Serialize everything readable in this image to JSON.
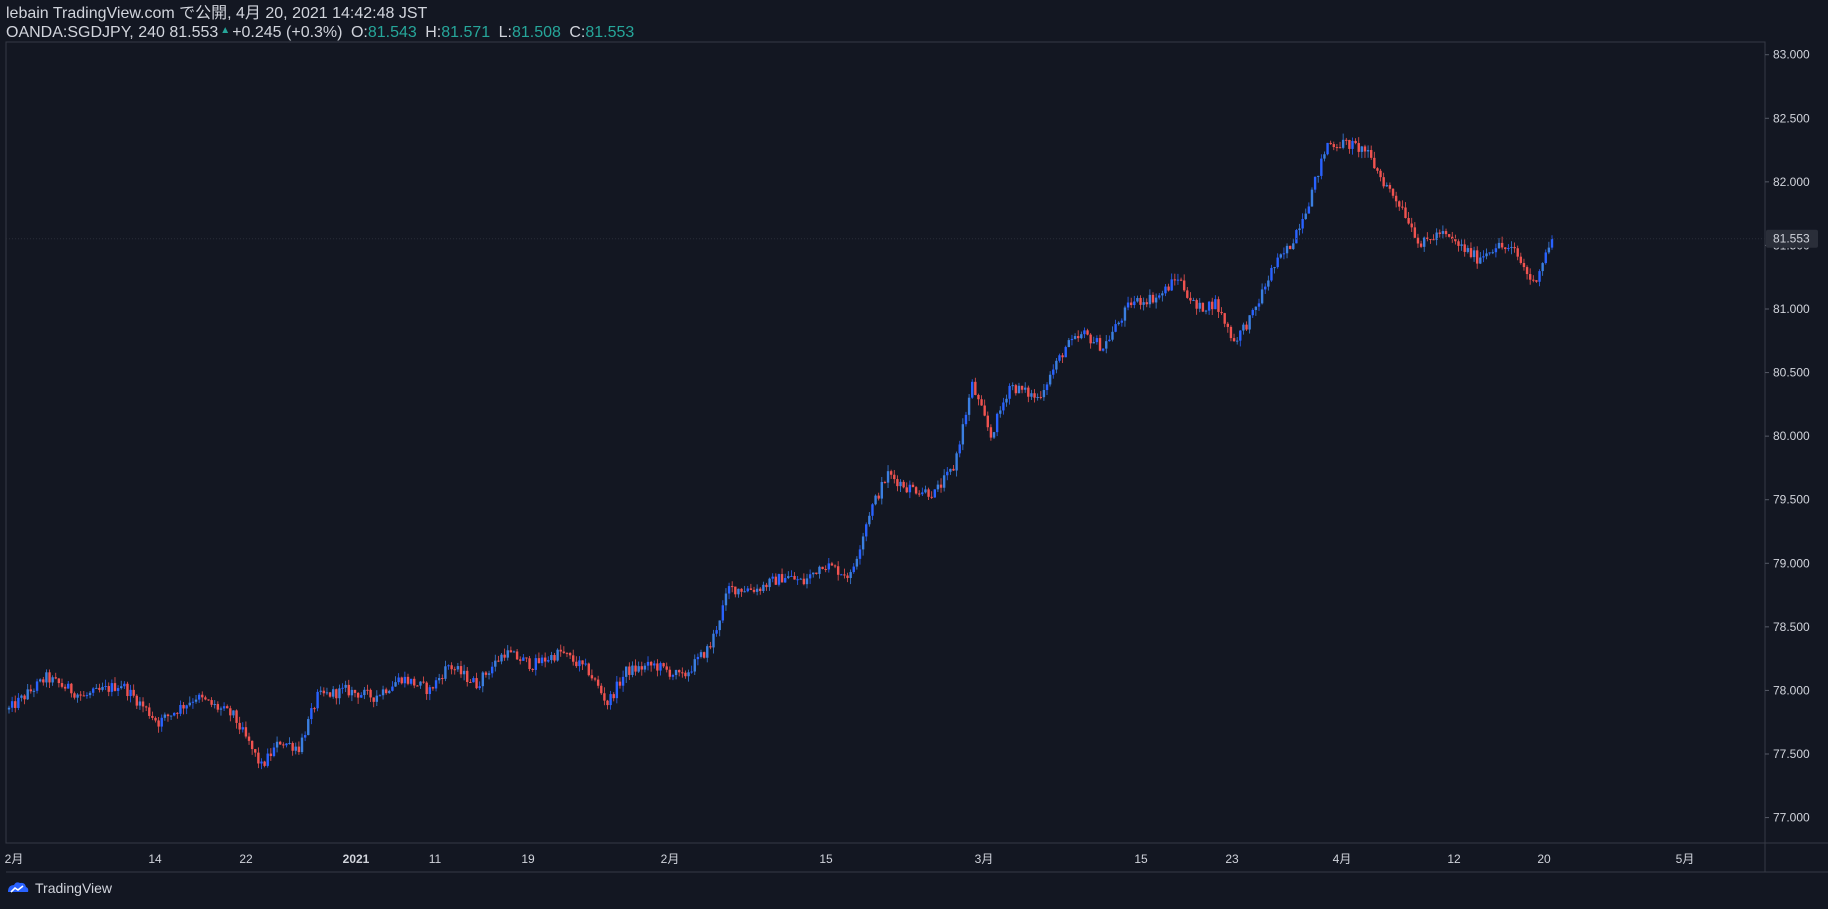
{
  "header": {
    "line1": "lebain TradingView.com で公開, 4月 20, 2021 14:42:48 JST",
    "symbol": "OANDA:SGDJPY, 240",
    "price": "81.553",
    "change": "+0.245 (+0.3%)",
    "o_label": "O:",
    "o_value": "81.543",
    "h_label": "H:",
    "h_value": "81.571",
    "l_label": "L:",
    "l_value": "81.508",
    "c_label": "C:",
    "c_value": "81.553"
  },
  "footer": {
    "brand": "TradingView"
  },
  "colors": {
    "up": "#2962ff",
    "up_alt": "#3b7fe0",
    "down": "#f05350",
    "background": "#131722",
    "grid": "#2a2e39",
    "text": "#d1d4dc",
    "accent": "#26a69a"
  },
  "chart_data": {
    "type": "candlestick",
    "ylim": [
      76.8,
      83.1
    ],
    "y_ticks": [
      "83.000",
      "82.500",
      "82.000",
      "81.500",
      "81.000",
      "80.500",
      "80.000",
      "79.500",
      "79.000",
      "78.500",
      "78.000",
      "77.500",
      "77.000"
    ],
    "y_tick_values": [
      83.0,
      82.5,
      82.0,
      81.5,
      81.0,
      80.5,
      80.0,
      79.5,
      79.0,
      78.5,
      78.0,
      77.5,
      77.0
    ],
    "x_ticks": [
      "2月",
      "14",
      "22",
      "2021",
      "11",
      "19",
      "2月",
      "15",
      "3月",
      "15",
      "23",
      "4月",
      "12",
      "20",
      "5月"
    ],
    "last_price": "81.553",
    "last_value": 81.553,
    "path": [
      [
        0,
        77.85
      ],
      [
        4,
        78.1
      ],
      [
        8,
        77.95
      ],
      [
        12,
        78.05
      ],
      [
        16,
        77.75
      ],
      [
        20,
        77.95
      ],
      [
        24,
        77.8
      ],
      [
        27,
        77.4
      ],
      [
        29,
        77.6
      ],
      [
        31,
        77.55
      ],
      [
        33,
        77.95
      ],
      [
        36,
        78.0
      ],
      [
        39,
        77.95
      ],
      [
        42,
        78.1
      ],
      [
        45,
        78.0
      ],
      [
        47,
        78.2
      ],
      [
        50,
        78.05
      ],
      [
        53,
        78.3
      ],
      [
        56,
        78.2
      ],
      [
        59,
        78.3
      ],
      [
        62,
        78.15
      ],
      [
        64,
        77.9
      ],
      [
        66,
        78.15
      ],
      [
        69,
        78.2
      ],
      [
        72,
        78.1
      ],
      [
        75,
        78.35
      ],
      [
        77,
        78.8
      ],
      [
        80,
        78.8
      ],
      [
        83,
        78.9
      ],
      [
        85,
        78.85
      ],
      [
        87,
        79.0
      ],
      [
        90,
        78.9
      ],
      [
        92,
        79.4
      ],
      [
        94,
        79.7
      ],
      [
        96,
        79.6
      ],
      [
        99,
        79.55
      ],
      [
        101,
        79.75
      ],
      [
        103,
        80.4
      ],
      [
        105,
        80.0
      ],
      [
        107,
        80.4
      ],
      [
        110,
        80.3
      ],
      [
        113,
        80.7
      ],
      [
        115,
        80.8
      ],
      [
        117,
        80.7
      ],
      [
        120,
        81.05
      ],
      [
        123,
        81.1
      ],
      [
        125,
        81.25
      ],
      [
        127,
        81.0
      ],
      [
        129,
        81.05
      ],
      [
        131,
        80.75
      ],
      [
        133,
        80.95
      ],
      [
        135,
        81.3
      ],
      [
        137,
        81.5
      ],
      [
        139,
        81.85
      ],
      [
        141,
        82.3
      ],
      [
        143,
        82.3
      ],
      [
        145,
        82.25
      ],
      [
        147,
        82.0
      ],
      [
        149,
        81.8
      ],
      [
        151,
        81.5
      ],
      [
        153,
        81.6
      ],
      [
        155,
        81.5
      ],
      [
        157,
        81.4
      ],
      [
        159,
        81.5
      ],
      [
        161,
        81.45
      ],
      [
        163,
        81.2
      ],
      [
        165,
        81.553
      ]
    ]
  }
}
